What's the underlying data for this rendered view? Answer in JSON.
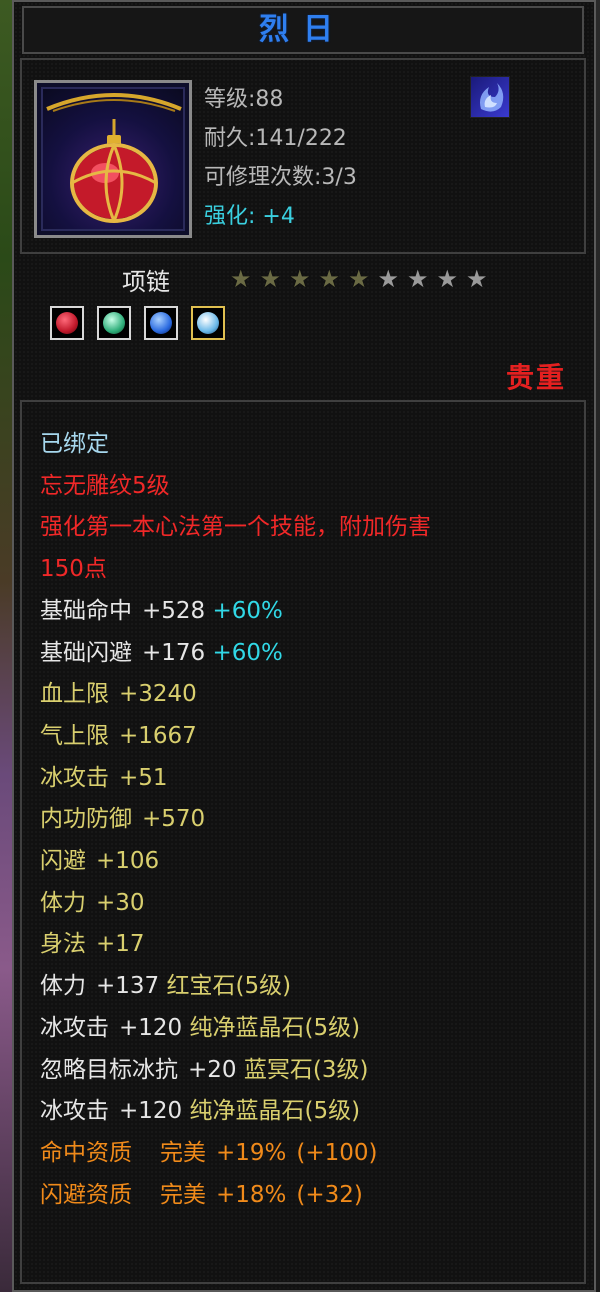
{
  "title": "烈日",
  "item": {
    "icon": "pendant-necklace-icon",
    "level_label": "等级:88",
    "durability_label": "耐久:141/222",
    "repair_label": "可修理次数:3/3",
    "enhance_label": "强化:",
    "enhance_value": "+4",
    "skill_icon": "flame-swirl-icon",
    "type": "项链",
    "stars": {
      "filled": 5,
      "total": 9
    },
    "gems": [
      {
        "icon": "red-gem-icon",
        "color": "#c0182a"
      },
      {
        "icon": "green-gem-icon",
        "color": "#2fae7a"
      },
      {
        "icon": "blue-gem-icon",
        "color": "#2a6ae0"
      },
      {
        "icon": "ice-gem-icon",
        "color": "#6ab8e8"
      }
    ],
    "rarity": "贵重"
  },
  "properties": {
    "bound": "已绑定",
    "special_name": "忘无雕纹5级",
    "special_desc_1": "强化第一本心法第一个技能，附加伤害",
    "special_desc_2": "150点",
    "hit_label": "基础命中",
    "hit_value": "+528",
    "hit_pct": "+60%",
    "dodge_label": "基础闪避",
    "dodge_value": "+176",
    "dodge_pct": "+60%",
    "stats": [
      {
        "label": "血上限",
        "value": "+3240"
      },
      {
        "label": "气上限",
        "value": "+1667"
      },
      {
        "label": "冰攻击",
        "value": "+51"
      },
      {
        "label": "内功防御",
        "value": "+570"
      },
      {
        "label": "闪避",
        "value": "+106"
      },
      {
        "label": "体力",
        "value": "+30"
      },
      {
        "label": "身法",
        "value": "+17"
      }
    ],
    "gem_stats": [
      {
        "label": "体力",
        "value": "+137",
        "gem": "红宝石(5级)"
      },
      {
        "label": "冰攻击",
        "value": "+120",
        "gem": "纯净蓝晶石(5级)"
      },
      {
        "label": "忽略目标冰抗",
        "value": "+20",
        "gem": "蓝冥石(3级)"
      },
      {
        "label": "冰攻击",
        "value": "+120",
        "gem": "纯净蓝晶石(5级)"
      }
    ],
    "aptitudes": [
      {
        "label": "命中资质",
        "grade": "完美",
        "value": "+19%",
        "bonus": "(+100)"
      },
      {
        "label": "闪避资质",
        "grade": "完美",
        "value": "+18%",
        "bonus": "(+32)"
      }
    ]
  },
  "colors": {
    "title_blue": "#2f7ff0",
    "stat_gold": "#d9cf6e",
    "cyan": "#31d8e6",
    "red": "#f02828",
    "orange": "#f08a1a"
  }
}
